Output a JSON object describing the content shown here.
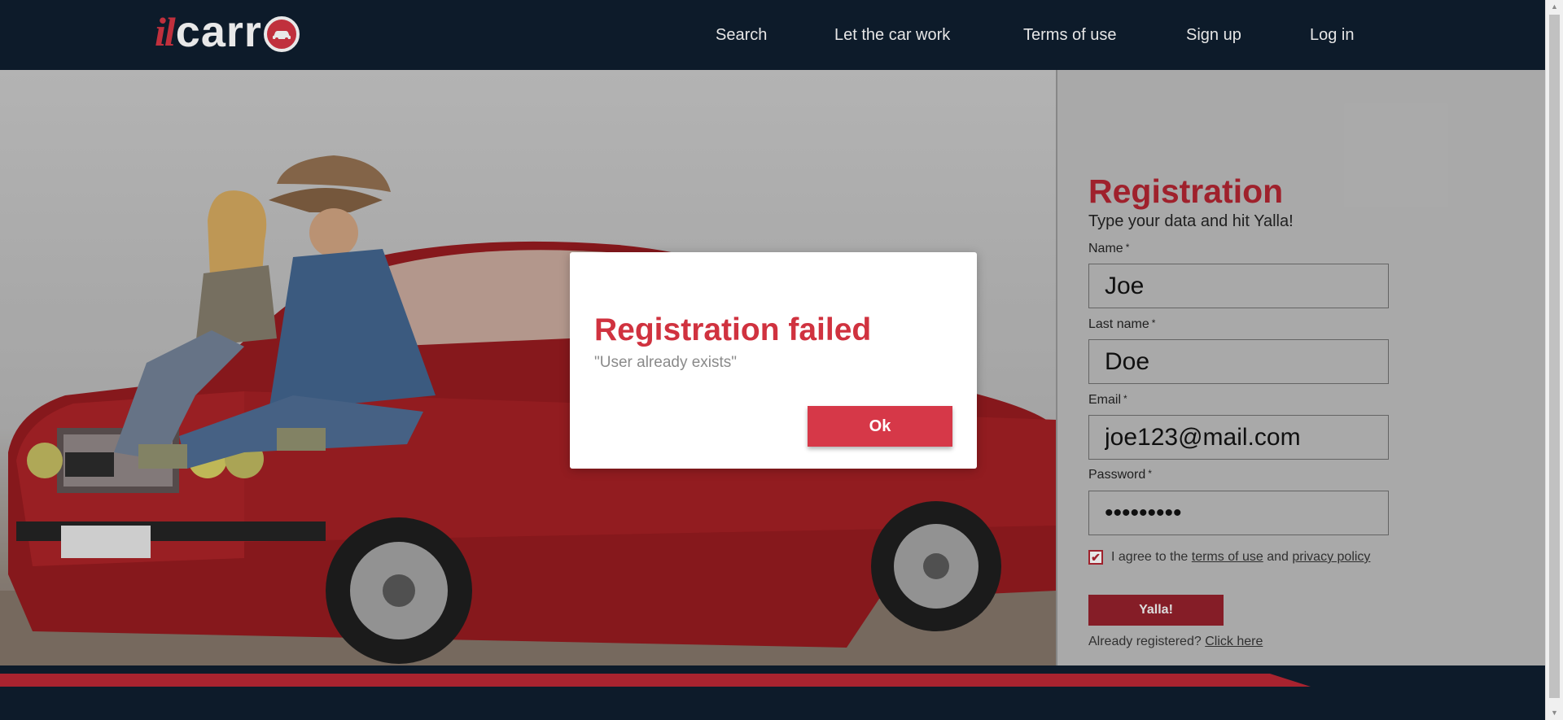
{
  "brand": {
    "logo_il": "il",
    "logo_carr": "carr"
  },
  "nav": [
    {
      "label": "Search"
    },
    {
      "label": "Let the car work"
    },
    {
      "label": "Terms of use"
    },
    {
      "label": "Sign up"
    },
    {
      "label": "Log in"
    }
  ],
  "form": {
    "title": "Registration",
    "subtitle": "Type your data and hit Yalla!",
    "fields": [
      {
        "label": "Name",
        "value": "Joe"
      },
      {
        "label": "Last name",
        "value": "Doe"
      },
      {
        "label": "Email",
        "value": "joe123@mail.com"
      },
      {
        "label": "Password",
        "value": "•••••••••"
      }
    ],
    "required_mark": "*",
    "agree": {
      "checked": true,
      "prefix": "I agree to the",
      "terms_link": "terms of use",
      "and": "and",
      "privacy_link": "privacy policy"
    },
    "submit_label": "Yalla!",
    "already_text": "Already registered?",
    "already_link": "Click here"
  },
  "modal": {
    "title": "Registration failed",
    "message": "\"User already exists\"",
    "ok_label": "Ok"
  },
  "colors": {
    "header_bg": "#0d1b2a",
    "brand_red": "#a8232f",
    "modal_accent": "#d0323f",
    "button_red": "#d63848"
  }
}
